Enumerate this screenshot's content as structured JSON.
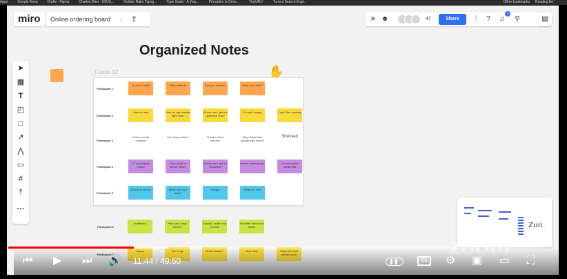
{
  "browser": {
    "bookmarks": [
      "Apps",
      "Google Keep",
      "Drafts - Figma",
      "Charles Dien - UI/UX...",
      "Golden Ratio Typog...",
      "Type Scale - A Visu...",
      "Principles to Drive...",
      "TinyURL!",
      "Torrent Search Engi..."
    ],
    "other_bookmarks": "Other bookmarks",
    "reading_list": "Reading list"
  },
  "app": {
    "logo": "miro",
    "board_name": "Online ordering board",
    "collaborator_count": "47",
    "share_label": "Share",
    "notification_badge": "1"
  },
  "canvas": {
    "title": "Organized Notes",
    "frame_label": "Frame 12",
    "rows": [
      {
        "label": "Participant 1",
        "notes": [
          {
            "text": "22 and Excited",
            "color": "orange"
          },
          {
            "text": "Likes referrals",
            "color": "orange"
          },
          {
            "text": "Can you deliver?",
            "color": "orange"
          },
          {
            "text": "What do I order?",
            "color": "orange"
          }
        ]
      },
      {
        "label": "Participant 2",
        "notes": [
          {
            "text": "Likes to read",
            "color": "yellow"
          },
          {
            "text": "How do I get started right now?",
            "color": "yellow"
          },
          {
            "text": "Where can I get my groceries now?",
            "color": "yellow"
          },
          {
            "text": "24 and Hungry",
            "color": "yellow"
          },
          {
            "text": "I don't like cooking",
            "color": "yellow"
          }
        ]
      },
      {
        "label": "Participant 3",
        "notes": [
          {
            "text": "Orders mostly cravings",
            "color": "white"
          },
          {
            "text": "Can I pay online?",
            "color": "white"
          },
          {
            "text": "Checks online vendors",
            "color": "white"
          },
          {
            "text": "Why bother they update their menu?",
            "color": "white"
          },
          {
            "text": "Stressed",
            "color": "white"
          }
        ]
      },
      {
        "label": "Participant 4",
        "notes": [
          {
            "text": "27 and enjoys eating",
            "color": "purple"
          },
          {
            "text": "How much to deliver there?",
            "color": "purple"
          },
          {
            "text": "Where can I get my favourites",
            "color": "purple"
          },
          {
            "text": "Needs ordering app",
            "color": "purple"
          },
          {
            "text": "Checks social media ads",
            "color": "purple"
          }
        ]
      },
      {
        "label": "Participant 5",
        "notes": [
          {
            "text": "18 and in school",
            "color": "blue"
          },
          {
            "text": "Which one do I order?",
            "color": "blue"
          },
          {
            "text": "Hungry",
            "color": "blue"
          },
          {
            "text": "What do I eat?",
            "color": "blue"
          }
        ]
      },
      {
        "label": "Participant 6",
        "notes": [
          {
            "text": "Indifferent",
            "color": "green"
          },
          {
            "text": "How can I save money",
            "color": "green"
          },
          {
            "text": "Should I order food at once",
            "color": "green"
          },
          {
            "text": "I'd rather have food online",
            "color": "green"
          }
        ]
      },
      {
        "label": "Participant 7",
        "notes": [
          {
            "text": "Happy",
            "color": "yellow"
          },
          {
            "text": "Can I pay",
            "color": "yellow"
          },
          {
            "text": "Orders food in",
            "color": "yellow"
          },
          {
            "text": "Very busy",
            "color": "yellow"
          },
          {
            "text": "I hope the food arrives soon",
            "color": "yellow"
          }
        ]
      }
    ]
  },
  "overlay": {
    "zuri_logo": "Zuri",
    "zuri_dot": ".",
    "zoom_watermark": "zoom"
  },
  "player": {
    "time_current": "11:44",
    "time_total": "49:50",
    "progress_fraction": 0.235,
    "buffered_fraction": 0.3,
    "cc_label": "CC"
  }
}
